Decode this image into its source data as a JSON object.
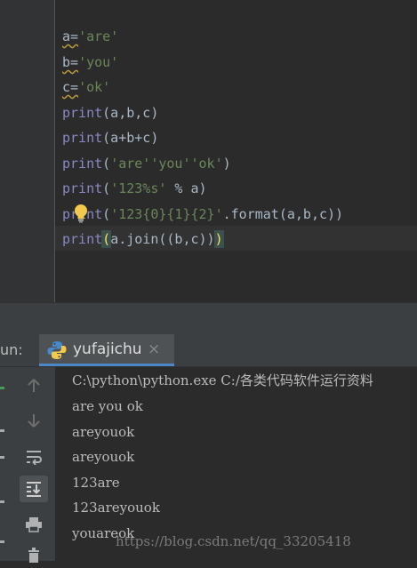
{
  "editor": {
    "lines": [
      {
        "a": "a=",
        "b": "'are'"
      },
      {
        "a": "b=",
        "b": "'you'"
      },
      {
        "a": "c=",
        "b": "'ok'"
      },
      {
        "kw": "print",
        "rest": "(a,b,c)"
      },
      {
        "kw": "print",
        "rest": "(a+b+c)"
      },
      {
        "kw": "print",
        "p1": "(",
        "s": "'are''you''ok'",
        "p2": ")"
      },
      {
        "kw": "print",
        "p1": "(",
        "s": "'123%s'",
        "p2": " % a)"
      },
      {
        "kw": "print",
        "p1": "(",
        "s": "'123{0}{1}{2}'",
        "p2": ".format(a,b,c))"
      },
      {
        "kw": "print",
        "open": "(",
        "mid": "a.join((b,c))",
        "close": ")"
      }
    ],
    "bulb_icon": "lightbulb-icon"
  },
  "run": {
    "label": "un:",
    "tab_title": "yufajichu",
    "tab_close": "×",
    "tab_icon": "python-icon",
    "tools": [
      "up-arrow-icon",
      "down-arrow-icon",
      "soft-wrap-icon",
      "scroll-to-end-icon",
      "print-icon",
      "trash-icon"
    ],
    "output": [
      "C:\\python\\python.exe C:/各类代码软件运行资料",
      "are you ok",
      "areyouok",
      "areyouok",
      "123are",
      "123areyouok",
      "youareok"
    ],
    "watermark": "https://blog.csdn.net/qq_33205418"
  },
  "colors": {
    "editor_bg": "#2b2b2b",
    "keyword": "#8888c6",
    "string": "#6a8759",
    "text": "#a9b7c6",
    "tab_underline": "#4a88c7"
  }
}
